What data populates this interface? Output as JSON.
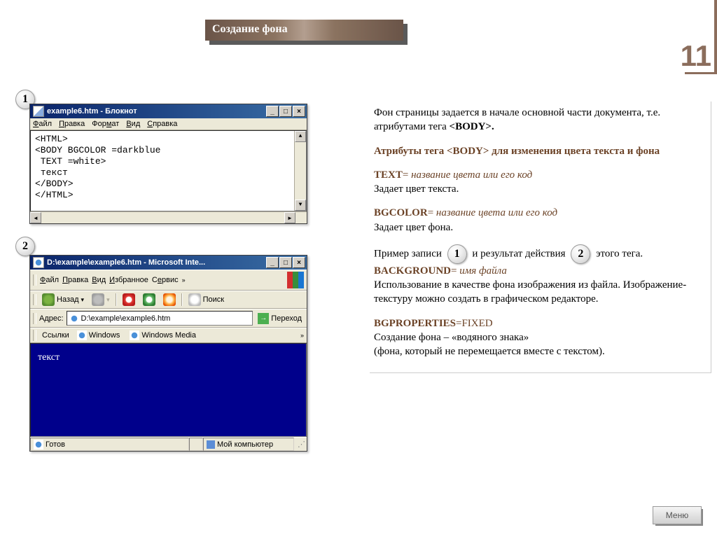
{
  "header": {
    "title": "Создание фона"
  },
  "page_number": "11",
  "badges": {
    "one": "1",
    "two": "2"
  },
  "notepad": {
    "title": "example6.htm - Блокнот",
    "menu": [
      "Файл",
      "Правка",
      "Формат",
      "Вид",
      "Справка"
    ],
    "code": "<HTML>\n<BODY BGCOLOR =darkblue\n TEXT =white>\n текст\n</BODY>\n</HTML>"
  },
  "ie": {
    "title": "D:\\example\\example6.htm - Microsoft Inte...",
    "menu": [
      "Файл",
      "Правка",
      "Вид",
      "Избранное",
      "Сервис"
    ],
    "back": "Назад",
    "search": "Поиск",
    "address_label": "Адрес:",
    "address_value": "D:\\example\\example6.htm",
    "go": "Переход",
    "links_label": "Ссылки",
    "links": [
      "Windows",
      "Windows Media"
    ],
    "body_text": "текст",
    "status": "Готов",
    "status_zone": "Мой компьютер"
  },
  "right": {
    "p1_a": "Фон страницы задается в начале основной части документа, т.е. атрибутами тега ",
    "p1_b": "<BODY>",
    "p1_c": ".",
    "p2_a": "Атрибуты тега ",
    "p2_b": "<BODY>",
    "p2_c": " для изменения цвета текста и фона",
    "text_attr": "TEXT",
    "text_eq": "= ",
    "text_val": "название цвета",
    "text_or": "    или его код",
    "text_desc": "Задает цвет текста.",
    "bg_attr": "BGCOLOR",
    "bg_eq": "= ",
    "bg_val": "название цвета или его код",
    "bg_desc": "Задает цвет фона.",
    "ex_a": "Пример записи",
    "ex_b": "и результат действия",
    "ex_c": "этого тега.",
    "bgd_attr": "BACKGROUND",
    "bgd_eq": "= ",
    "bgd_val": "имя файла",
    "bgd_desc": "Использование в качестве фона изображения из файла. Изображение-текстуру можно создать в графическом редакторе.",
    "bgp_attr": "BGPROPERTIES",
    "bgp_eq": "=",
    "bgp_val": "FIXED",
    "bgp_desc1": "Создание фона – «водяного знака»",
    "bgp_desc2": "(фона, который не перемещается вместе с текстом)."
  },
  "menu_button": "Меню"
}
